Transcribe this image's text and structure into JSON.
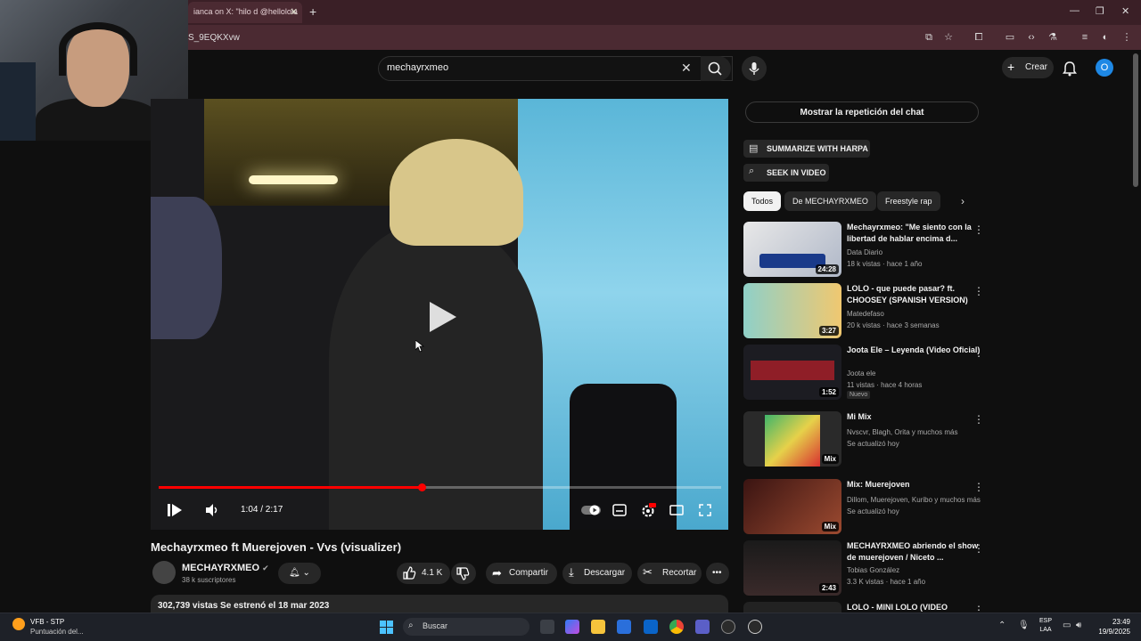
{
  "browser": {
    "tab_title": "ianca on X: \"hilo d @hellolola",
    "address": "S_9EQKXvw"
  },
  "search": {
    "query": "mechayrxmeo"
  },
  "header": {
    "create_label": "Crear",
    "avatar_letter": "O"
  },
  "player": {
    "time_display": "1:04 / 2:17",
    "progress": 0.467
  },
  "video": {
    "title": "Mechayrxmeo ft Muerejoven - Vvs (visualizer)",
    "channel": "MECHAYRXMEO",
    "subscribers": "38 k suscriptores",
    "likes": "4.1 K",
    "share_label": "Compartir",
    "download_label": "Descargar",
    "clip_label": "Recortar",
    "description_line": "302,739 vistas  Se estrenó el 18 mar 2023"
  },
  "sidebar": {
    "chat_replay": "Mostrar la repetición del chat",
    "harpa_summarize": "SUMMARIZE WITH HARPA",
    "harpa_seek": "SEEK IN VIDEO",
    "chips": [
      "Todos",
      "De MECHAYRXMEO",
      "Freestyle rap"
    ],
    "recommendations": [
      {
        "title": "Mechayrxmeo: \"Me siento con la libertad de hablar encima d...",
        "channel": "Data Diario",
        "meta": "18 k vistas · hace 1 año",
        "duration": "24:28"
      },
      {
        "title": "LOLO - que puede pasar? ft. CHOOSEY (SPANISH VERSION)",
        "channel": "Matedefaso",
        "meta": "20 k vistas · hace 3 semanas",
        "duration": "3:27"
      },
      {
        "title": "Joota Ele – Leyenda (Video Oficial)",
        "channel": "Joota ele",
        "meta": "11 vistas · hace 4 horas",
        "duration": "1:52",
        "badge": "Nuevo"
      },
      {
        "title": "Mi Mix",
        "channel": "Nvscvr, Blagh, Orita y muchos más",
        "meta": "Se actualizó hoy",
        "duration": "Mix"
      },
      {
        "title": "Mix: Muerejoven",
        "channel": "Dillom, Muerejoven, Kuribo y muchos más",
        "meta": "Se actualizó hoy",
        "duration": "Mix"
      },
      {
        "title": "MECHAYRXMEO abriendo el show de muerejoven / Niceto ...",
        "channel": "Tobias González",
        "meta": "3.3 K vistas · hace 1 año",
        "duration": "2:43"
      },
      {
        "title": "LOLO - MINI LOLO (VIDEO",
        "channel": "",
        "meta": "",
        "duration": ""
      }
    ]
  },
  "taskbar": {
    "weather_line1": "VFB - STP",
    "weather_line2": "Puntuación del...",
    "search_label": "Buscar",
    "lang_line1": "ESP",
    "lang_line2": "LAA",
    "time": "23:49",
    "date": "19/9/2025"
  },
  "colors": {
    "accent_red": "#ff0000",
    "background": "#0f0f0f",
    "browser_frame": "#3a1f26"
  }
}
